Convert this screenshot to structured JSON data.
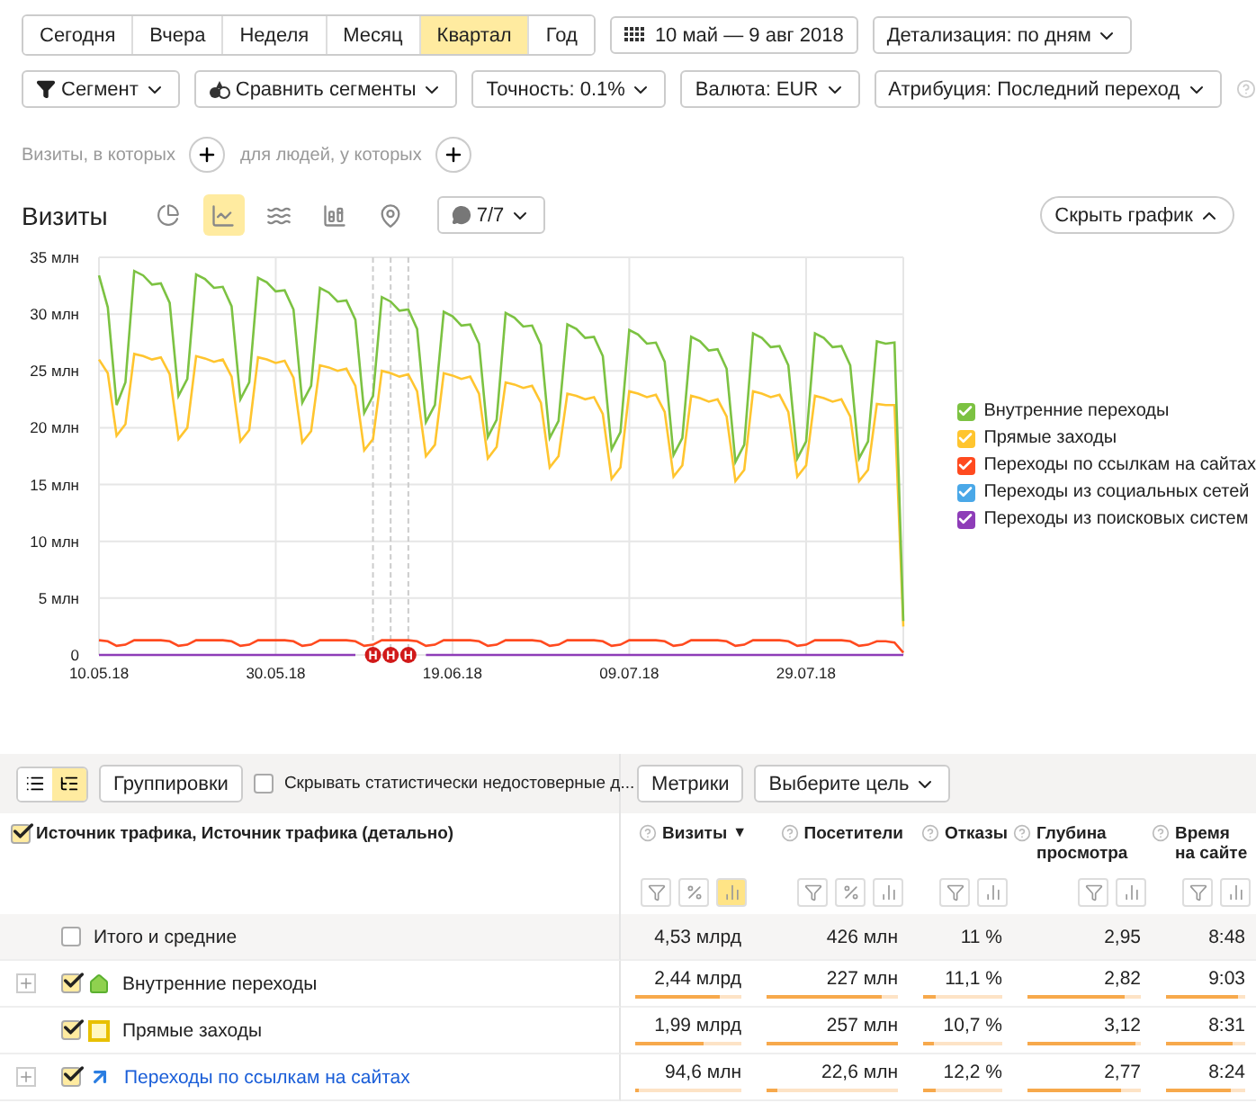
{
  "period_tabs": [
    {
      "label": "Сегодня",
      "selected": false
    },
    {
      "label": "Вчера",
      "selected": false
    },
    {
      "label": "Неделя",
      "selected": false
    },
    {
      "label": "Месяц",
      "selected": false
    },
    {
      "label": "Квартал",
      "selected": true
    },
    {
      "label": "Год",
      "selected": false
    }
  ],
  "date_range": "10 май — 9 авг 2018",
  "detail_dropdown": "Детализация: по дням",
  "filters": [
    {
      "kind": "segment",
      "label": "Сегмент"
    },
    {
      "kind": "compare",
      "label": "Сравнить сегменты"
    },
    {
      "kind": "plain",
      "label": "Точность: 0.1%"
    },
    {
      "kind": "plain",
      "label": "Валюта: EUR"
    },
    {
      "kind": "plain",
      "label": "Атрибуция: Последний переход"
    }
  ],
  "conditions": [
    "Визиты, в которых",
    "для людей, у которых"
  ],
  "chart_panel": {
    "title": "Визиты",
    "chart_types": [
      {
        "kind": "pie",
        "selected": false
      },
      {
        "kind": "line",
        "selected": true
      },
      {
        "kind": "area",
        "selected": false
      },
      {
        "kind": "column",
        "selected": false
      },
      {
        "kind": "map",
        "selected": false
      }
    ],
    "notes_button": "7/7",
    "hide_button": "Скрыть график",
    "chart_data": {
      "type": "line",
      "grid": true,
      "categories": [
        "10.05.18",
        null,
        null,
        null,
        null,
        null,
        null,
        null,
        null,
        null,
        null,
        null,
        null,
        null,
        null,
        null,
        null,
        null,
        null,
        null,
        "30.05.18",
        null,
        null,
        null,
        null,
        null,
        null,
        null,
        null,
        null,
        null,
        null,
        null,
        null,
        null,
        null,
        null,
        null,
        null,
        null,
        "19.06.18",
        null,
        null,
        null,
        null,
        null,
        null,
        null,
        null,
        null,
        null,
        null,
        null,
        null,
        null,
        null,
        null,
        null,
        null,
        null,
        "09.07.18",
        null,
        null,
        null,
        null,
        null,
        null,
        null,
        null,
        null,
        null,
        null,
        null,
        null,
        null,
        null,
        null,
        null,
        null,
        null,
        "29.07.18",
        null,
        null,
        null,
        null,
        null,
        null,
        null,
        null,
        null,
        null,
        null
      ],
      "ylim": [
        0,
        35
      ],
      "yticks": [
        {
          "value": 0,
          "label": "0"
        },
        {
          "value": 5,
          "label": "5 млн"
        },
        {
          "value": 10,
          "label": "10 млн"
        },
        {
          "value": 15,
          "label": "15 млн"
        },
        {
          "value": 20,
          "label": "20 млн"
        },
        {
          "value": 25,
          "label": "25 млн"
        },
        {
          "value": 30,
          "label": "30 млн"
        },
        {
          "value": 35,
          "label": "35 млн"
        }
      ],
      "series": [
        {
          "name": "Внутренние переходы",
          "color": "#7cc242",
          "values": [
            33.4,
            30.6,
            22.0,
            24.0,
            33.8,
            33.4,
            32.6,
            32.7,
            31.0,
            22.8,
            24.3,
            33.5,
            33.1,
            32.3,
            32.4,
            30.7,
            22.5,
            24.0,
            33.2,
            32.8,
            32.0,
            32.1,
            30.4,
            22.2,
            23.7,
            32.3,
            31.9,
            31.1,
            31.2,
            29.5,
            21.3,
            22.8,
            31.5,
            31.1,
            30.3,
            30.4,
            28.7,
            20.5,
            22.0,
            30.2,
            29.8,
            29.0,
            29.1,
            27.4,
            19.2,
            20.7,
            30.1,
            29.7,
            28.9,
            29.0,
            27.3,
            19.1,
            20.6,
            29.1,
            28.7,
            27.9,
            28.0,
            26.3,
            18.1,
            19.6,
            28.6,
            28.2,
            27.4,
            27.5,
            25.8,
            17.6,
            19.1,
            28.0,
            27.6,
            26.8,
            26.9,
            25.2,
            17.0,
            18.5,
            28.3,
            27.9,
            27.1,
            27.2,
            25.5,
            17.3,
            18.8,
            28.3,
            27.9,
            27.1,
            27.2,
            25.5,
            17.3,
            18.8,
            27.6,
            27.4,
            27.5,
            3.0
          ]
        },
        {
          "name": "Прямые заходы",
          "color": "#ffc52f",
          "values": [
            26.0,
            24.8,
            19.3,
            20.3,
            26.5,
            26.3,
            26.0,
            26.2,
            24.7,
            19.0,
            20.0,
            26.3,
            26.1,
            25.8,
            26.0,
            24.5,
            18.8,
            19.8,
            26.2,
            26.0,
            25.7,
            25.9,
            24.4,
            18.7,
            19.7,
            25.5,
            25.3,
            25.0,
            25.2,
            23.7,
            18.0,
            19.0,
            25.0,
            24.8,
            24.5,
            24.7,
            23.2,
            17.5,
            18.5,
            24.8,
            24.6,
            24.3,
            24.5,
            23.0,
            17.3,
            18.3,
            24.0,
            23.8,
            23.5,
            23.7,
            22.2,
            16.5,
            17.5,
            23.0,
            22.8,
            22.5,
            22.7,
            21.2,
            15.5,
            16.5,
            23.2,
            23.0,
            22.7,
            22.9,
            21.4,
            15.7,
            16.7,
            22.8,
            22.6,
            22.3,
            22.5,
            21.0,
            15.3,
            16.3,
            23.2,
            23.0,
            22.7,
            22.9,
            21.4,
            15.7,
            16.7,
            22.8,
            22.6,
            22.3,
            22.5,
            21.0,
            15.3,
            16.3,
            22.1,
            22.0,
            22.0,
            2.5
          ]
        },
        {
          "name": "Переходы по ссылкам на сайтах",
          "color": "#ff4a1f",
          "values": [
            1.3,
            1.2,
            0.8,
            0.9,
            1.3,
            1.3,
            1.3,
            1.3,
            1.2,
            0.8,
            0.9,
            1.3,
            1.3,
            1.3,
            1.3,
            1.2,
            0.8,
            0.9,
            1.3,
            1.3,
            1.3,
            1.3,
            1.2,
            0.8,
            0.9,
            1.3,
            1.3,
            1.3,
            1.3,
            1.2,
            0.8,
            0.9,
            1.3,
            1.3,
            1.3,
            1.3,
            1.2,
            0.8,
            0.9,
            1.3,
            1.3,
            1.3,
            1.3,
            1.2,
            0.8,
            0.9,
            1.3,
            1.3,
            1.3,
            1.3,
            1.2,
            0.8,
            0.9,
            1.3,
            1.3,
            1.3,
            1.3,
            1.2,
            0.8,
            0.9,
            1.3,
            1.3,
            1.3,
            1.3,
            1.2,
            0.8,
            0.9,
            1.3,
            1.3,
            1.3,
            1.3,
            1.2,
            0.8,
            0.9,
            1.3,
            1.3,
            1.3,
            1.3,
            1.2,
            0.8,
            0.9,
            1.3,
            1.3,
            1.3,
            1.3,
            1.2,
            0.8,
            0.9,
            1.2,
            1.2,
            1.1,
            0.2
          ]
        },
        {
          "name": "Переходы из социальных сетей",
          "color": "#4aa8e8",
          "values": [
            null,
            null,
            null,
            null,
            null,
            null,
            null,
            null,
            null,
            null,
            null,
            null,
            null,
            null,
            null,
            null,
            null,
            null,
            null,
            null,
            null,
            null,
            null,
            null,
            null,
            null,
            null,
            null,
            null,
            null,
            null,
            null,
            null,
            null,
            null,
            null,
            null,
            null,
            null,
            null,
            null,
            null,
            null,
            null,
            null,
            null,
            null,
            null,
            null,
            null,
            null,
            null,
            null,
            null,
            null,
            null,
            null,
            null,
            null,
            null,
            null,
            null,
            null,
            null,
            null,
            null,
            null,
            null,
            null,
            null,
            null,
            null,
            null,
            null,
            null,
            null,
            null,
            null,
            null,
            null,
            null,
            null,
            null,
            null,
            null,
            null,
            null,
            null,
            null,
            null,
            null,
            null
          ]
        },
        {
          "name": "Переходы из поисковых систем",
          "color": "#8e3db8",
          "values": [
            0,
            0,
            0,
            0,
            0,
            0,
            0,
            0,
            0,
            0,
            0,
            0,
            0,
            0,
            0,
            0,
            0,
            0,
            0,
            0,
            0,
            0,
            0,
            0,
            0,
            0,
            0,
            0,
            0,
            0,
            null,
            null,
            null,
            null,
            null,
            null,
            null,
            0,
            0,
            0,
            0,
            0,
            0,
            0,
            0,
            0,
            0,
            0,
            0,
            0,
            0,
            0,
            0,
            0,
            0,
            0,
            0,
            0,
            0,
            0,
            0,
            0,
            0,
            0,
            0,
            0,
            0,
            0,
            0,
            0,
            0,
            0,
            0,
            0,
            0,
            0,
            0,
            0,
            0,
            0,
            0,
            0,
            0,
            0,
            0,
            0,
            0,
            0,
            0,
            0,
            0,
            0
          ]
        }
      ],
      "annotations": [
        {
          "text": "Н"
        },
        {
          "text": "Н"
        },
        {
          "text": "Н"
        }
      ]
    }
  },
  "table": {
    "toolbar": {
      "views": [
        {
          "kind": "list",
          "selected": false
        },
        {
          "kind": "tree",
          "selected": true
        }
      ],
      "group_button": "Группировки",
      "hide_unreliable": {
        "label": "Скрывать статистически недостоверные д...",
        "checked": false
      },
      "metrics_button": "Метрики",
      "goal_dropdown": "Выберите цель"
    },
    "dimension": {
      "label": "Источник трафика, Источник трафика (детально)",
      "checked": true
    },
    "columns": [
      {
        "label": "Визиты",
        "sort": "▼",
        "tools": [
          {
            "kind": "filter",
            "selected": false
          },
          {
            "kind": "percent",
            "selected": false
          },
          {
            "kind": "bars",
            "selected": true
          }
        ]
      },
      {
        "label": "Посетители",
        "tools": [
          {
            "kind": "filter",
            "selected": false
          },
          {
            "kind": "percent",
            "selected": false
          },
          {
            "kind": "bars",
            "selected": false
          }
        ]
      },
      {
        "label": "Отказы",
        "tools": [
          {
            "kind": "filter",
            "selected": false
          },
          {
            "kind": "bars",
            "selected": false
          }
        ]
      },
      {
        "label": "Глубина просмотра",
        "tools": [
          {
            "kind": "filter",
            "selected": false
          },
          {
            "kind": "bars",
            "selected": false
          }
        ]
      },
      {
        "label": "Время на сайте",
        "tools": [
          {
            "kind": "filter",
            "selected": false
          },
          {
            "kind": "bars",
            "selected": false
          }
        ]
      }
    ],
    "rows": [
      {
        "kind": "total",
        "label": "Итого и средние",
        "checked": false,
        "expandable": false,
        "cells": [
          {
            "value": "4,53 млрд"
          },
          {
            "value": "426 млн"
          },
          {
            "value": "11 %"
          },
          {
            "value": "2,95"
          },
          {
            "value": "8:48"
          }
        ]
      },
      {
        "kind": "internal",
        "expandable": true,
        "checked": true,
        "label": "Внутренние переходы",
        "cells": [
          {
            "value": "2,44 млрд",
            "level": 0.8
          },
          {
            "value": "227 млн",
            "level": 0.88
          },
          {
            "value": "11,1 %",
            "level": 0.15
          },
          {
            "value": "2,82",
            "level": 0.85
          },
          {
            "value": "9:03",
            "level": 0.9
          }
        ]
      },
      {
        "kind": "direct",
        "expandable": false,
        "checked": true,
        "label": "Прямые заходы",
        "cells": [
          {
            "value": "1,99 млрд",
            "level": 0.65
          },
          {
            "value": "257 млн",
            "level": 1
          },
          {
            "value": "10,7 %",
            "level": 0.14
          },
          {
            "value": "3,12",
            "level": 0.95
          },
          {
            "value": "8:31",
            "level": 0.85
          }
        ]
      },
      {
        "kind": "referral",
        "expandable": true,
        "checked": true,
        "label": "Переходы по ссылкам на сайтах",
        "cells": [
          {
            "value": "94,6 млн",
            "level": 0.03
          },
          {
            "value": "22,6 млн",
            "level": 0.08
          },
          {
            "value": "12,2 %",
            "level": 0.15
          },
          {
            "value": "2,77",
            "level": 0.82
          },
          {
            "value": "8:24",
            "level": 0.82
          }
        ]
      }
    ]
  }
}
